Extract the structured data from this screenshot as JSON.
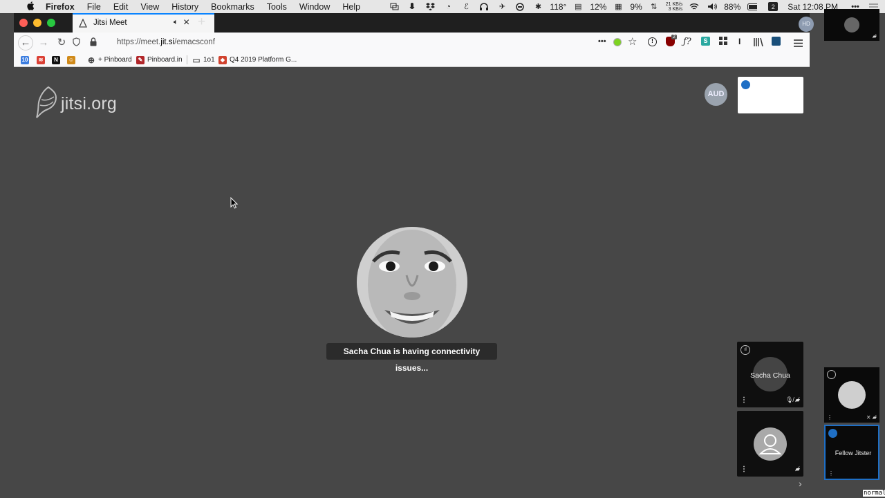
{
  "menubar": {
    "app": "Firefox",
    "items": [
      "File",
      "Edit",
      "View",
      "History",
      "Bookmarks",
      "Tools",
      "Window",
      "Help"
    ],
    "status": {
      "temperature": "118°",
      "cpu": "12%",
      "memory": "9%",
      "net_down": "21 KB/s",
      "net_up": "3 KB/s",
      "battery": "88%",
      "calendar_day": "2",
      "clock": "Sat 12:08 PM"
    }
  },
  "browser": {
    "tab": {
      "title": "Jitsi Meet"
    },
    "url": {
      "prefix": "https://meet.",
      "host": "jit.si",
      "path": "/emacsconf"
    },
    "extension_badge": "2",
    "bookmarks": [
      {
        "label": "",
        "icon": "calendar-icon",
        "color": "#3b7de0"
      },
      {
        "label": "",
        "icon": "todoist-icon",
        "color": "#db4035"
      },
      {
        "label": "",
        "icon": "notion-icon",
        "color": "#111111"
      },
      {
        "label": "",
        "icon": "bookmark-icon",
        "color": "#d08a1a"
      },
      {
        "label": "+ Pinboard",
        "icon": "globe-icon",
        "color": "#444444"
      },
      {
        "label": "Pinboard.in",
        "icon": "pinboard-icon",
        "color": "#b1262a"
      },
      {
        "label": "1o1",
        "icon": "folder-icon",
        "color": "#666666"
      },
      {
        "label": "Q4 2019 Platform G...",
        "icon": "slides-icon",
        "color": "#d1422e"
      }
    ]
  },
  "jitsi": {
    "logo_text": "jitsi.org",
    "avatar_aud": "AUD",
    "toast": "Sacha Chua is having connectivity issues...",
    "thumbnails": [
      {
        "name": "Sacha Chua"
      },
      {
        "name": ""
      }
    ]
  },
  "side_panel": {
    "avatar_hd": "HD",
    "fellow_name": "Fellow Jitster",
    "mode_label": "normal"
  },
  "colors": {
    "content_bg": "#474747",
    "tab_accent": "#0a84ff",
    "indicator_blue": "#1f6fc5"
  }
}
